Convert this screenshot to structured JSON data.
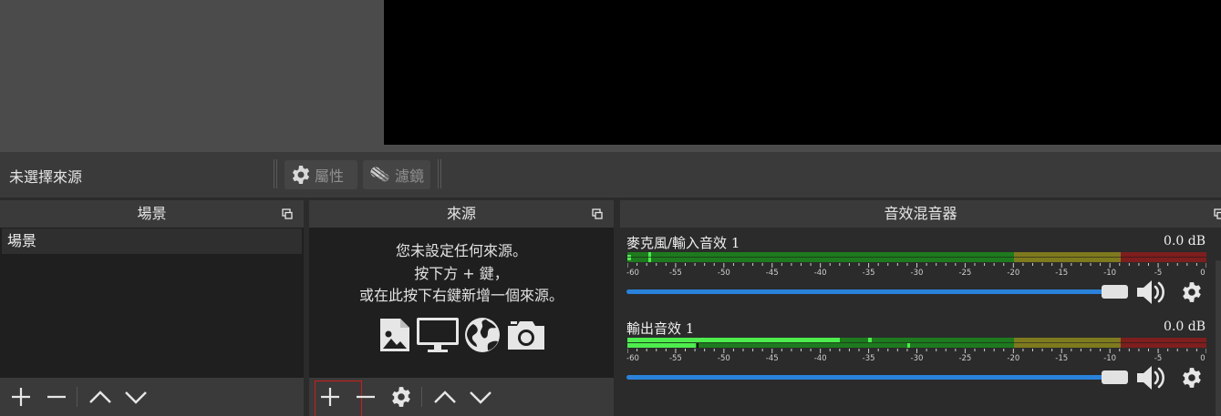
{
  "context": {
    "no_source_label": "未選擇來源",
    "properties_label": "屬性",
    "filters_label": "濾鏡"
  },
  "scenes": {
    "title": "場景",
    "items": [
      {
        "label": "場景",
        "selected": true
      }
    ]
  },
  "sources": {
    "title": "來源",
    "empty_line1": "您未設定任何來源。",
    "empty_line2": "按下方 + 鍵，",
    "empty_line3": "或在此按下右鍵新增一個來源。",
    "icons": [
      "image-icon",
      "display-icon",
      "globe-icon",
      "camera-icon"
    ]
  },
  "mixer": {
    "title": "音效混音器",
    "scale_labels": [
      "-60",
      "-55",
      "-50",
      "-45",
      "-40",
      "-35",
      "-30",
      "-25",
      "-20",
      "-15",
      "-10",
      "-5",
      "0"
    ],
    "channels": [
      {
        "name": "麥克風/輸入音效 1",
        "db": "0.0 dB",
        "volume": 1.0,
        "level_db": -59
      },
      {
        "name": "輸出音效 1",
        "db": "0.0 dB",
        "volume": 1.0,
        "level_db": -36
      }
    ]
  },
  "colors": {
    "accent": "#2a82da",
    "meter_green": "#1e7a1e",
    "meter_yellow": "#7e7a1e",
    "meter_red": "#7e1e1e",
    "meter_green_active": "#4ded4d",
    "selection_outline": "#d11b1b"
  }
}
